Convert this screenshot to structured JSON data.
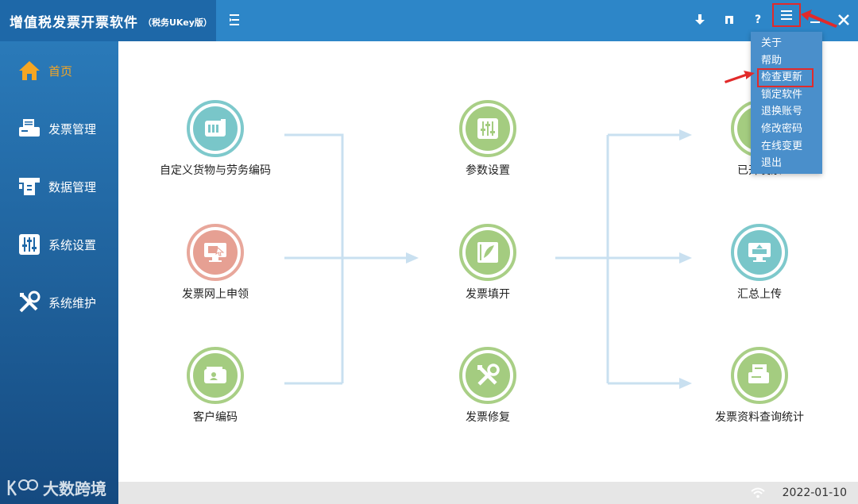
{
  "app": {
    "title": "增值税发票开票软件",
    "subtitle": "（税务UKey版）"
  },
  "titlebar_buttons": [
    {
      "name": "download-icon"
    },
    {
      "name": "pin-icon"
    },
    {
      "name": "help-icon",
      "label": "?"
    },
    {
      "name": "menu-icon"
    },
    {
      "name": "minimize-icon"
    },
    {
      "name": "close-icon"
    }
  ],
  "sidebar": {
    "items": [
      {
        "label": "首页",
        "icon": "home-icon",
        "active": true
      },
      {
        "label": "发票管理",
        "icon": "invoice-printer-icon"
      },
      {
        "label": "数据管理",
        "icon": "data-management-icon"
      },
      {
        "label": "系统设置",
        "icon": "settings-sliders-icon"
      },
      {
        "label": "系统维护",
        "icon": "tools-icon"
      }
    ]
  },
  "workflow": {
    "left": [
      {
        "label": "自定义货物与劳务编码",
        "icon": "goods-code-icon",
        "color": "teal"
      },
      {
        "label": "发票网上申领",
        "icon": "online-apply-icon",
        "color": "pink"
      },
      {
        "label": "客户编码",
        "icon": "customer-code-icon",
        "color": "green"
      }
    ],
    "middle": [
      {
        "label": "参数设置",
        "icon": "parameter-settings-icon",
        "color": "green"
      },
      {
        "label": "发票填开",
        "icon": "invoice-fill-icon",
        "color": "green"
      },
      {
        "label": "发票修复",
        "icon": "invoice-repair-icon",
        "color": "green"
      }
    ],
    "right": [
      {
        "label": "已开发票",
        "icon": "issued-invoice-icon",
        "color": "green"
      },
      {
        "label": "汇总上传",
        "icon": "summary-upload-icon",
        "color": "teal"
      },
      {
        "label": "发票资料查询统计",
        "icon": "invoice-query-icon",
        "color": "green"
      }
    ]
  },
  "dropdown_menu": {
    "items": [
      "关于",
      "帮助",
      "检查更新",
      "锁定软件",
      "退换账号",
      "修改密码",
      "在线变更",
      "退出"
    ],
    "highlighted_index": 2
  },
  "statusbar": {
    "date": "2022-01-10"
  },
  "watermark": {
    "text": "大数跨境"
  },
  "colors": {
    "titlebar": "#2d86c8",
    "sidebar": "#1e68a8",
    "active": "#f5a623",
    "teal": "#79c6c9",
    "pink": "#e6a093",
    "green": "#a4cc80",
    "highlight": "#e22a2a"
  }
}
